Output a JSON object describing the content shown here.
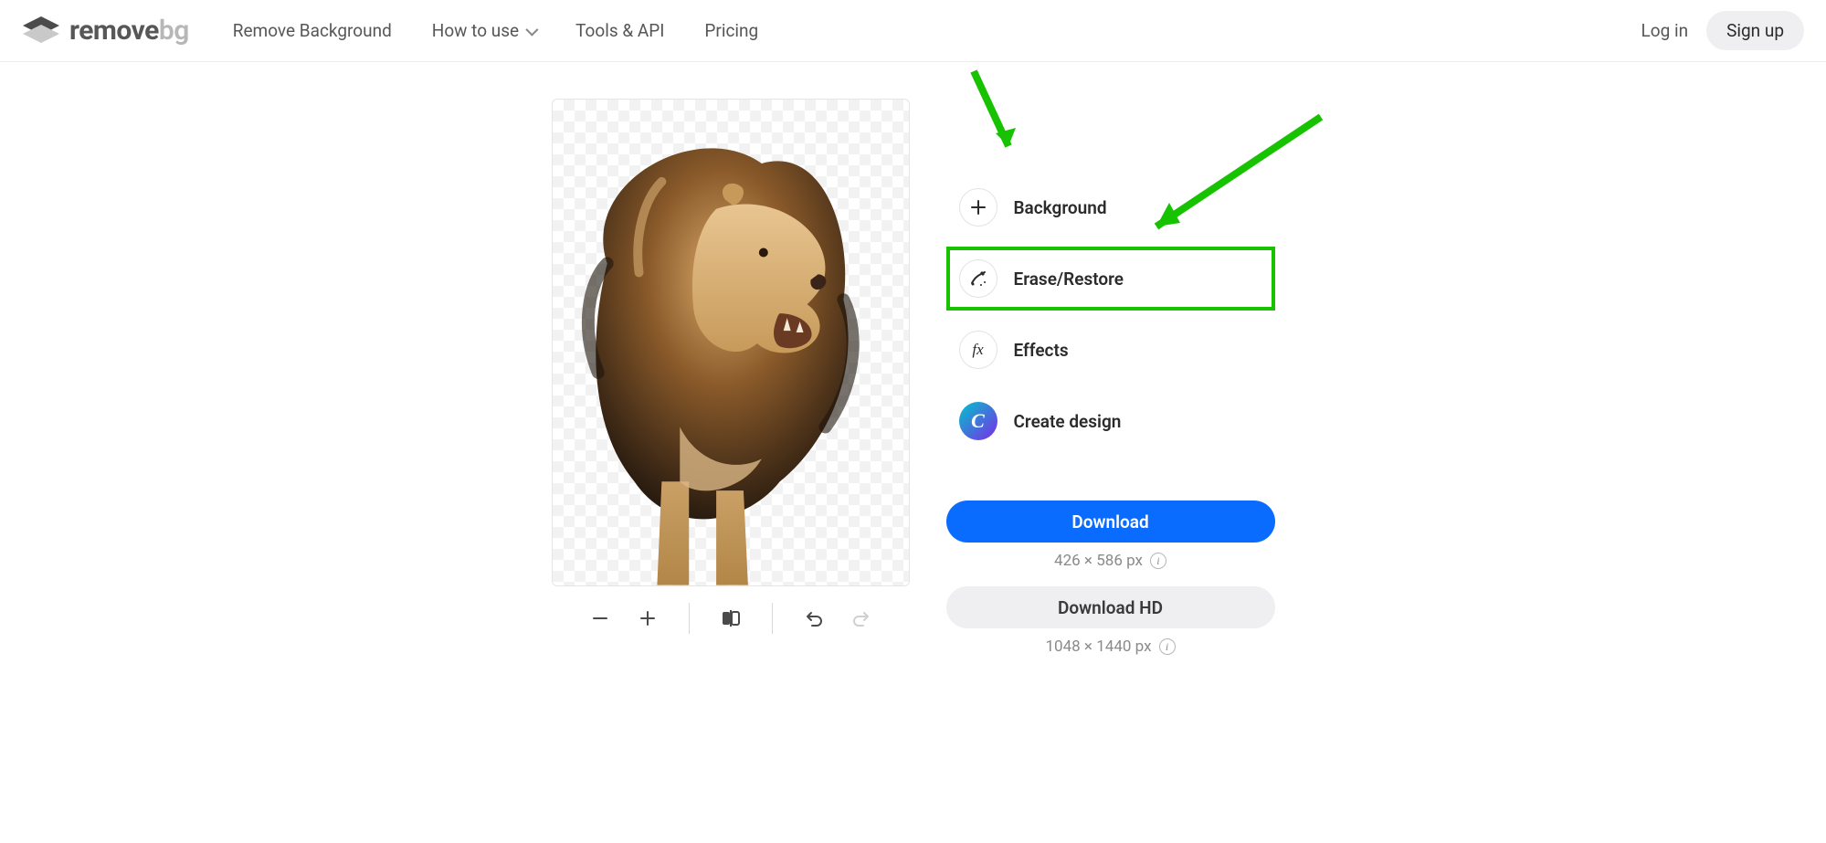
{
  "brand": {
    "name_left": "remove",
    "name_right": "bg"
  },
  "nav": {
    "remove_bg": "Remove Background",
    "how_to_use": "How to use",
    "tools_api": "Tools & API",
    "pricing": "Pricing"
  },
  "auth": {
    "login": "Log in",
    "signup": "Sign up"
  },
  "tools": {
    "background": "Background",
    "erase_restore": "Erase/Restore",
    "effects": "Effects",
    "create_design": "Create design"
  },
  "download": {
    "primary": "Download",
    "primary_dims": "426 × 586 px",
    "hd": "Download HD",
    "hd_dims": "1048 × 1440 px"
  },
  "canvas": {
    "subject": "lion with mane roaring, background removed"
  },
  "colors": {
    "accent": "#0a6cff",
    "annotation": "#17c200"
  }
}
